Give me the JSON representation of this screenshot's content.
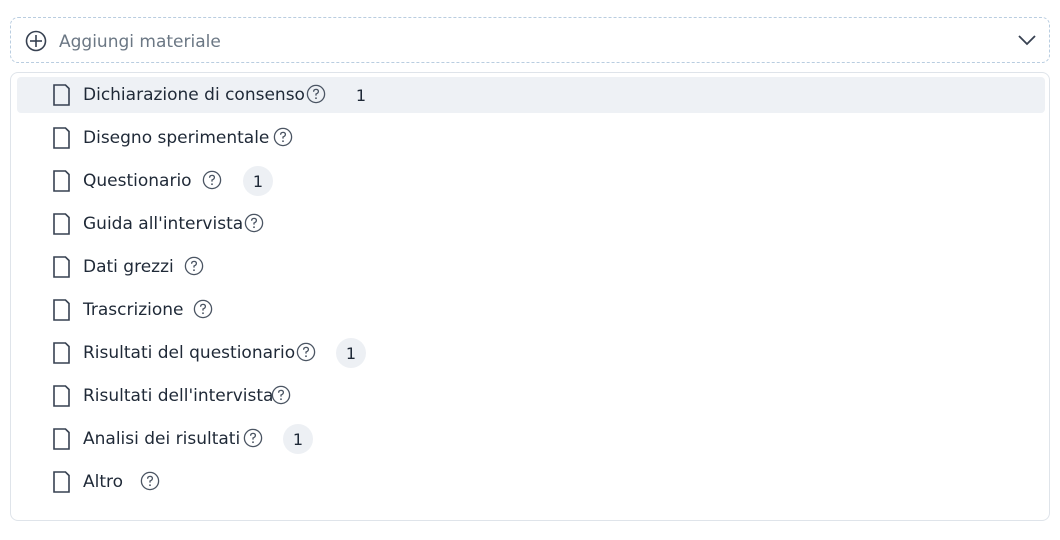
{
  "add_material": {
    "icon": "plus-circle-icon",
    "placeholder": "Aggiungi materiale",
    "dropdown_icon": "chevron-down-icon"
  },
  "materials": {
    "items": [
      {
        "label": "Dichiarazione di consenso",
        "count": "1",
        "selected": true
      },
      {
        "label": "Disegno sperimentale"
      },
      {
        "label": "Questionario",
        "count": "1"
      },
      {
        "label": "Guida all'intervista"
      },
      {
        "label": "Dati grezzi"
      },
      {
        "label": "Trascrizione"
      },
      {
        "label": "Risultati del questionario",
        "count": "1"
      },
      {
        "label": "Risultati dell'intervista"
      },
      {
        "label": "Analisi dei risultati",
        "count": "1"
      },
      {
        "label": "Altro"
      }
    ]
  },
  "colors": {
    "selected_row": "#eef1f5",
    "badge_bg": "#edf0f4",
    "icon": "#374151",
    "placeholder": "#6b7784",
    "dashed_border": "#b9cde0"
  }
}
